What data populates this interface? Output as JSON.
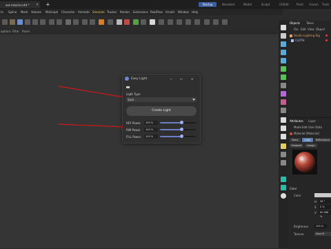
{
  "document_tab": {
    "title": "ase tutorial.c4d *",
    "close": "×"
  },
  "new_tab": "+",
  "layouts": [
    "Startup",
    "Standard",
    "Model",
    "Sculpt",
    "UVEdit",
    "Paint",
    "Groom",
    "Track"
  ],
  "menu": [
    "ts",
    "Spline",
    "Mesh",
    "Volume",
    "MoGraph",
    "Character",
    "Animate",
    "Simulate",
    "Tracker",
    "Render",
    "Extensions",
    "RealFlow",
    "Arnold",
    "Window",
    "Help"
  ],
  "viewport_menu": [
    "options",
    "Filter",
    "Panel"
  ],
  "objects_panel": {
    "tabs": [
      "Objects",
      "Takes"
    ],
    "menu": [
      "File",
      "Edit",
      "View",
      "Object"
    ],
    "rows": [
      {
        "label": "Studio Lighting Rig",
        "color": "#e0a060"
      },
      {
        "label": "CLOTH",
        "color": "#b0c4ff"
      }
    ]
  },
  "attributes_panel": {
    "tabs": [
      "Attributes",
      "Layer"
    ],
    "menu": [
      "Mode",
      "Edit",
      "User Data"
    ],
    "object_name": "Material [Material]",
    "buttons": [
      "Basic",
      "Color",
      "Reflectance"
    ],
    "subbuttons": [
      "Viewport",
      "Assign"
    ],
    "section": "Color",
    "color_label": "Color",
    "channels": [
      "H",
      "S",
      "V"
    ],
    "values": [
      "58 °",
      "0 %",
      "80.588 %"
    ],
    "brightness_label": "Brightness",
    "brightness_value": "100 %",
    "texture_label": "Texture",
    "texture_value": "kiya.tif"
  },
  "dialog": {
    "title": "Easy Light",
    "minimize": "—",
    "maximize": "☐",
    "close": "✕",
    "light_type_label": "Light Type",
    "light_type_value": "Spot",
    "create_button": "Create Light",
    "sliders": [
      {
        "label": "KEY Power",
        "value": "100 %",
        "level": 0.6
      },
      {
        "label": "RIM Power",
        "value": "100 %",
        "level": 0.6
      },
      {
        "label": "FILL Power",
        "value": "100 %",
        "level": 0.6
      }
    ]
  },
  "colors": {
    "accent": "#3a5fa0",
    "arrow": "#d01818",
    "slider": "#6d7fc9"
  }
}
